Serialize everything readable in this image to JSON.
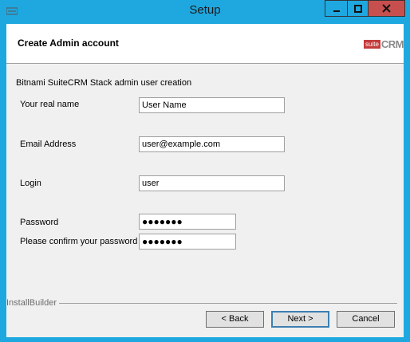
{
  "window": {
    "title": "Setup",
    "controls": {
      "minimize": "–",
      "maximize": "□",
      "close": "✕"
    },
    "accent_color": "#1fa8e0",
    "close_color": "#c7504f"
  },
  "header": {
    "title": "Create Admin account",
    "logo": {
      "suite": "suite",
      "crm": "CRM"
    }
  },
  "form": {
    "section_title": "Bitnami SuiteCRM Stack admin user creation",
    "fields": {
      "real_name": {
        "label": "Your real name",
        "value": "User Name"
      },
      "email": {
        "label": "Email Address",
        "value": "user@example.com"
      },
      "login": {
        "label": "Login",
        "value": "user"
      },
      "password": {
        "label": "Password",
        "value": "●●●●●●●"
      },
      "confirm": {
        "label": "Please confirm your password",
        "value": "●●●●●●●"
      }
    }
  },
  "footer": {
    "brand": "InstallBuilder",
    "buttons": {
      "back": "< Back",
      "next": "Next >",
      "cancel": "Cancel"
    }
  }
}
